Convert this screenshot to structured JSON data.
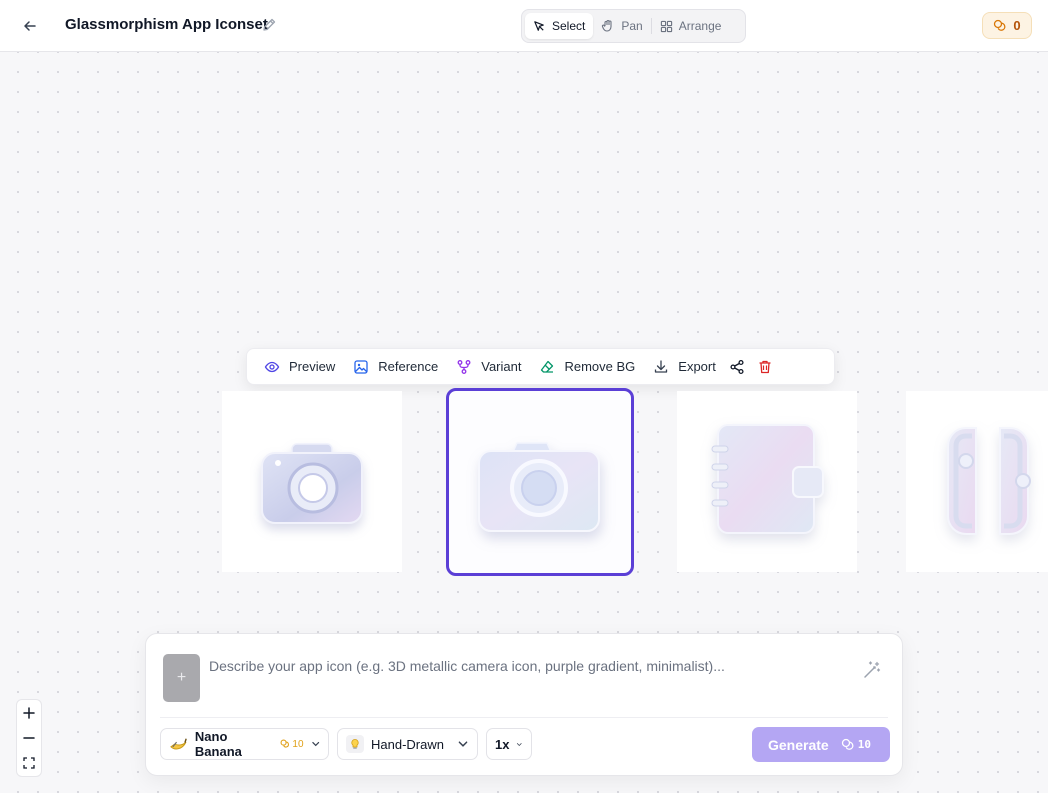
{
  "header": {
    "title": "Glassmorphism App Iconset",
    "tools": [
      {
        "label": "Select",
        "icon": "cursor-icon",
        "active": true
      },
      {
        "label": "Pan",
        "icon": "hand-icon",
        "active": false
      },
      {
        "label": "Arrange",
        "icon": "grid-icon",
        "active": false
      }
    ],
    "credits": "0"
  },
  "action_bar": {
    "preview": "Preview",
    "reference": "Reference",
    "variant": "Variant",
    "remove_bg": "Remove BG",
    "export": "Export"
  },
  "canvas": {
    "items": [
      {
        "icon": "camera-icon",
        "selected": false
      },
      {
        "icon": "camera-icon",
        "selected": true
      },
      {
        "icon": "notebook-icon",
        "selected": false
      },
      {
        "icon": "game-controller-icon",
        "selected": false
      }
    ]
  },
  "prompt": {
    "attach_label": "+",
    "placeholder": "Describe your app icon (e.g. 3D metallic camera icon, purple gradient, minimalist)...",
    "value": "",
    "model": {
      "label": "Nano Banana",
      "cost": "10"
    },
    "style": {
      "label": "Hand-Drawn"
    },
    "scale": {
      "label": "1x"
    },
    "generate": {
      "label": "Generate",
      "cost": "10"
    }
  },
  "zoom": {
    "in": "+",
    "out": "−"
  },
  "colors": {
    "accent": "#5b3fd6",
    "generate_bg": "#b4a6f3",
    "credit_text": "#b45309",
    "delete": "#dc2626"
  }
}
